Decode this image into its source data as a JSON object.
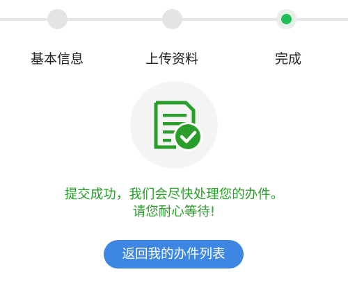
{
  "theme": {
    "accent_green": "#2a9e2a",
    "active_dot": "#1fbf55",
    "button_blue": "#3d87e3"
  },
  "stepper": {
    "steps": [
      {
        "label": "基本信息",
        "state": "done"
      },
      {
        "label": "上传资料",
        "state": "done"
      },
      {
        "label": "完成",
        "state": "active"
      }
    ]
  },
  "result": {
    "icon": "document-check-icon",
    "message_line1": "提交成功，我们会尽快处理您的办件。",
    "message_line2": "请您耐心等待!"
  },
  "actions": {
    "back_label": "返回我的办件列表"
  }
}
